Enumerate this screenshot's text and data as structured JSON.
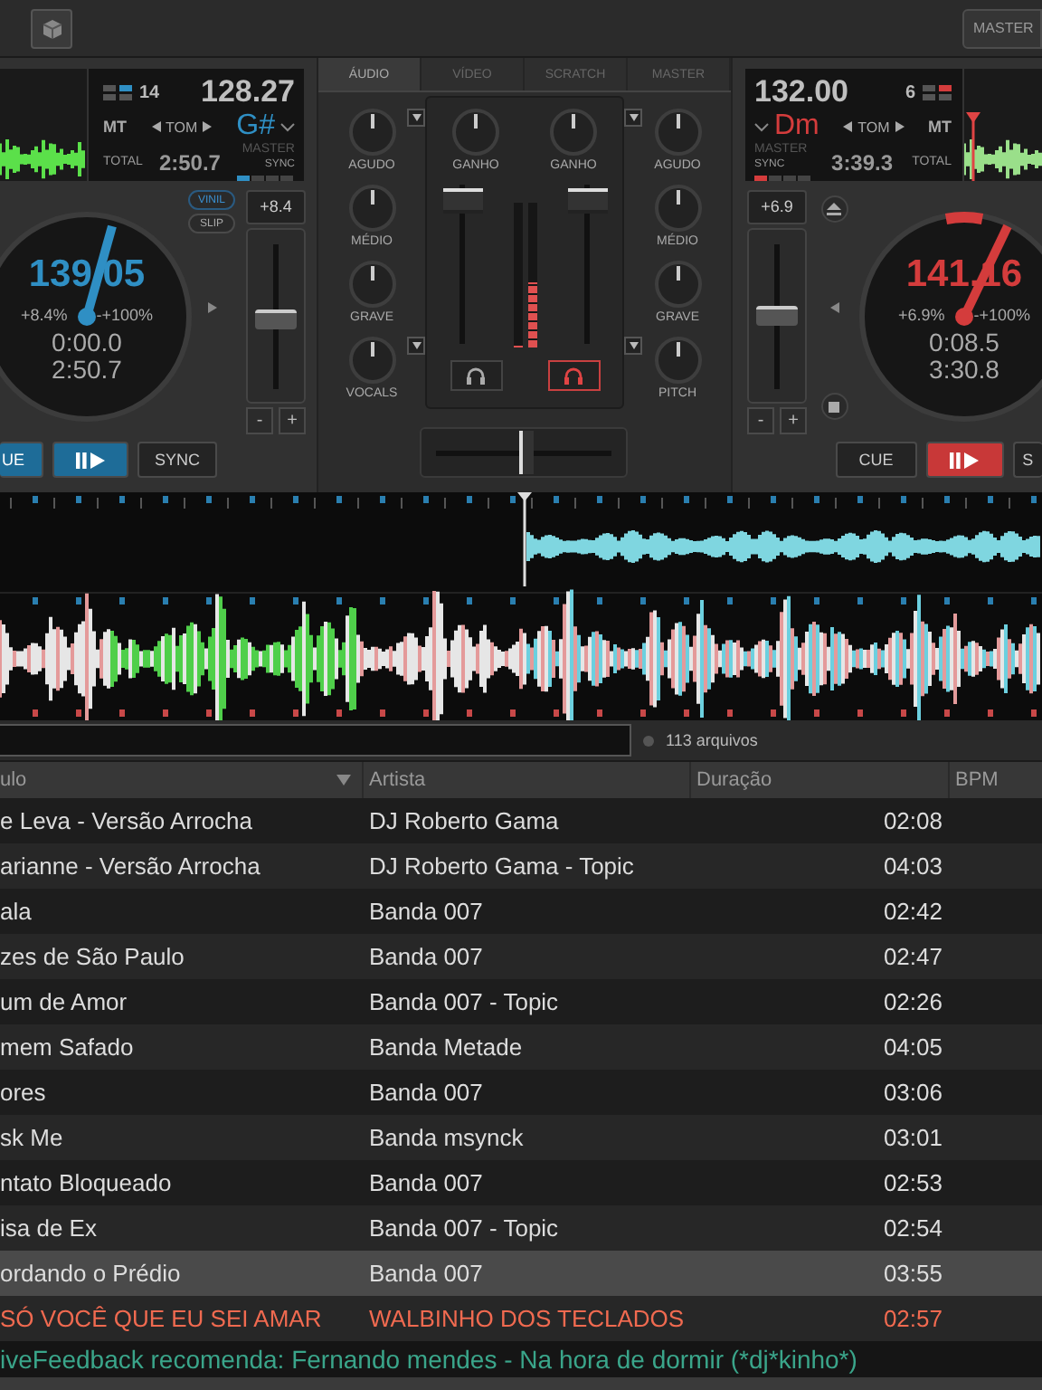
{
  "top_bar": {
    "master": "MASTER"
  },
  "decks": [
    {
      "kind": "left",
      "color": "#2f8fc4",
      "track_number": "14",
      "bpm": "128.27",
      "mode": "MT",
      "tom": "TOM",
      "key": "G#",
      "total_label": "TOTAL",
      "total": "2:50.7",
      "master": "MASTER",
      "sync_label": "SYNC",
      "vinil": {
        "label": "VINIL",
        "selected": true
      },
      "slip": {
        "label": "SLIP",
        "selected": false
      },
      "pitch_slider": {
        "reading": "+8.4",
        "level": 0.45,
        "minus": "-",
        "plus": "+"
      },
      "jog": {
        "bpm": "139.05",
        "pitch_percent": "+8.4%",
        "range": "-+100%",
        "elapsed": "0:00.0",
        "remaining": "2:50.7"
      },
      "cue": "UE",
      "sync": "SYNC"
    },
    {
      "kind": "right",
      "color": "#d43c3c",
      "track_number": "6",
      "bpm": "132.00",
      "mode": "MT",
      "tom": "TOM",
      "key": "Dm",
      "total_label": "TOTAL",
      "total": "3:39.3",
      "master": "MASTER",
      "sync_label": "SYNC",
      "pitch_slider": {
        "reading": "+6.9",
        "level": 0.48,
        "minus": "-",
        "plus": "+"
      },
      "jog": {
        "bpm": "141.16",
        "pitch_percent": "+6.9%",
        "range": "-+100%",
        "elapsed": "0:08.5",
        "remaining": "3:30.8"
      },
      "cue": "CUE",
      "sync": "S"
    }
  ],
  "mixer": {
    "tabs": [
      {
        "label": "ÁUDIO",
        "selected": true
      },
      {
        "label": "VÍDEO",
        "selected": false
      },
      {
        "label": "SCRATCH",
        "selected": false
      },
      {
        "label": "MASTER",
        "selected": false
      }
    ],
    "left_knobs": [
      {
        "label": "AGUDO",
        "menu": true
      },
      {
        "label": "MÉDIO",
        "menu": false
      },
      {
        "label": "GRAVE",
        "menu": false
      },
      {
        "label": "VOCALS",
        "menu": true
      }
    ],
    "right_knobs": [
      {
        "label": "AGUDO",
        "menu": true
      },
      {
        "label": "MÉDIO",
        "menu": false
      },
      {
        "label": "GRAVE",
        "menu": false
      },
      {
        "label": "PITCH",
        "menu": true
      }
    ],
    "channels": [
      {
        "gain_label": "GANHO",
        "fader": {
          "level": 0.92
        },
        "vu": {
          "level": 0
        },
        "headphones": {
          "on": false
        }
      },
      {
        "gain_label": "GANHO",
        "fader": {
          "level": 0.92
        },
        "vu": {
          "level": 0.45
        },
        "headphones": {
          "on": true
        }
      }
    ],
    "crossfader": {
      "level": 0.5
    }
  },
  "browser": {
    "file_count": "113 arquivos",
    "columns": [
      "ulo",
      "Artista",
      "Duração",
      "BPM"
    ],
    "rows": [
      {
        "title": "e Leva - Versão Arrocha",
        "artist": "DJ Roberto Gama",
        "duration": "02:08",
        "selected": false,
        "playing": false
      },
      {
        "title": "arianne - Versão Arrocha",
        "artist": "DJ Roberto Gama - Topic",
        "duration": "04:03",
        "selected": false,
        "playing": false
      },
      {
        "title": "ala",
        "artist": "Banda 007",
        "duration": "02:42",
        "selected": false,
        "playing": false
      },
      {
        "title": "zes de São Paulo",
        "artist": "Banda 007",
        "duration": "02:47",
        "selected": false,
        "playing": false
      },
      {
        "title": "um de Amor",
        "artist": "Banda 007 - Topic",
        "duration": "02:26",
        "selected": false,
        "playing": false
      },
      {
        "title": "mem Safado",
        "artist": "Banda Metade",
        "duration": "04:05",
        "selected": false,
        "playing": false
      },
      {
        "title": "ores",
        "artist": "Banda 007",
        "duration": "03:06",
        "selected": false,
        "playing": false
      },
      {
        "title": "sk Me",
        "artist": "Banda msynck",
        "duration": "03:01",
        "selected": false,
        "playing": false
      },
      {
        "title": "ntato Bloqueado",
        "artist": "Banda 007",
        "duration": "02:53",
        "selected": false,
        "playing": false
      },
      {
        "title": "isa de Ex",
        "artist": "Banda 007 - Topic",
        "duration": "02:54",
        "selected": false,
        "playing": false
      },
      {
        "title": "ordando o Prédio",
        "artist": "Banda 007",
        "duration": "03:55",
        "selected": true,
        "playing": false
      },
      {
        "title": "SÓ VOCÊ QUE EU SEI AMAR",
        "artist": "WALBINHO DOS TECLADOS",
        "duration": "02:57",
        "selected": false,
        "playing": true
      }
    ]
  },
  "status": {
    "text": "iveFeedback recomenda: Fernando mendes - Na hora de dormir (*dj*kinho*)"
  }
}
